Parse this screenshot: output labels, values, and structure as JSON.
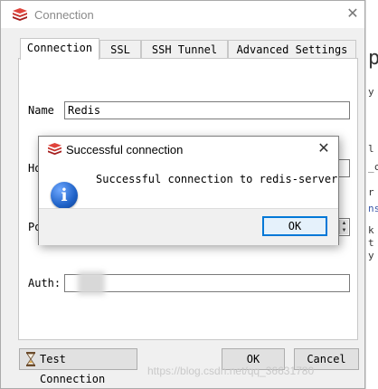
{
  "window": {
    "title": "Connection",
    "close_glyph": "✕"
  },
  "tabs": [
    {
      "label": "Connection"
    },
    {
      "label": "SSL"
    },
    {
      "label": "SSH Tunnel"
    },
    {
      "label": "Advanced Settings"
    }
  ],
  "form": {
    "name_label": "Name",
    "name_value": "Redis",
    "host_label_partial": "Ho",
    "port_label_partial": "Po",
    "auth_label": "Auth:"
  },
  "footer": {
    "test_label": "Test Connection",
    "ok_label": "OK",
    "cancel_label": "Cancel"
  },
  "dialog": {
    "title": "Successful connection",
    "message": "Successful connection to redis-server",
    "ok_label": "OK",
    "close_glyph": "✕",
    "info_glyph": "i"
  },
  "background": {
    "fragments": [
      "p",
      "y",
      "l",
      "_c",
      "r",
      "ns",
      "k",
      "t",
      "y"
    ]
  },
  "watermark": "https://blog.csdn.net/qq_36631780",
  "colors": {
    "accent_blue": "#0078d7",
    "redis_red": "#c6302b",
    "info_blue": "#1f62c7"
  }
}
